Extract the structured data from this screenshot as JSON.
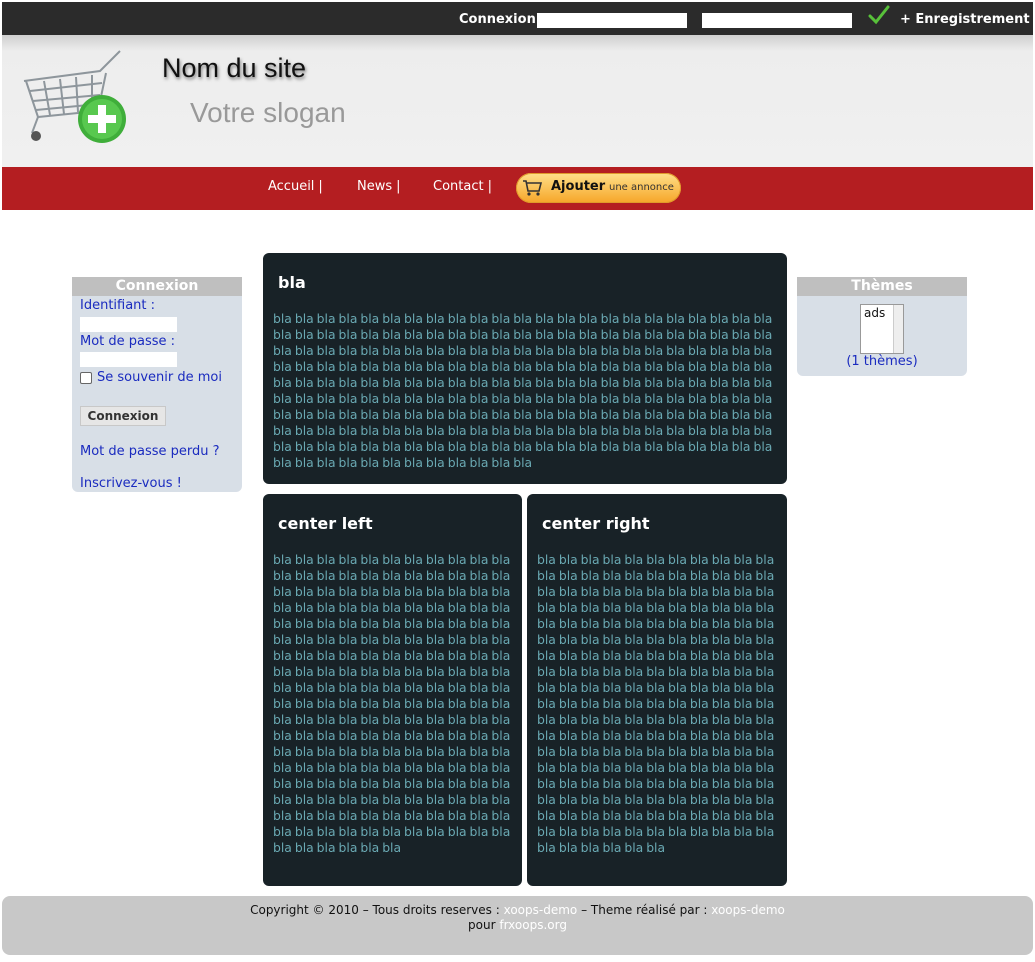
{
  "topbar": {
    "login_label": "Connexion",
    "register_label": "+ Enregistrement"
  },
  "header": {
    "site_name": "Nom du site",
    "slogan": "Votre slogan"
  },
  "menu": {
    "items": [
      "Accueil",
      "News",
      "Contact"
    ],
    "separator": "|",
    "add_button": {
      "main": "Ajouter",
      "sub": "une annonce"
    }
  },
  "login_box": {
    "title": "Connexion",
    "username_label": "Identifiant :",
    "password_label": "Mot de passe :",
    "remember_label": "Se souvenir de moi",
    "submit_label": "Connexion",
    "lost_password": "Mot de passe perdu ?",
    "register": "Inscrivez-vous !"
  },
  "themes_box": {
    "title": "Thèmes",
    "option": "ads",
    "count": "(1 thèmes)"
  },
  "blocks": {
    "top": {
      "title": "bla",
      "body": "bla bla bla bla bla bla bla bla bla bla bla bla bla bla bla bla bla bla bla bla bla bla bla bla bla bla bla bla bla bla bla bla bla bla bla bla bla bla bla bla bla bla bla bla bla bla bla bla bla bla bla bla bla bla bla bla bla bla bla bla bla bla bla bla bla bla bla bla bla bla bla bla bla bla bla bla bla bla bla bla bla bla bla bla bla bla bla bla bla bla bla bla bla bla bla bla bla bla bla bla bla bla bla bla bla bla bla bla bla bla bla bla bla bla bla bla bla bla bla bla bla bla bla bla bla bla bla bla bla bla bla bla bla bla bla bla bla bla bla bla bla bla bla bla bla bla bla bla bla bla bla bla bla bla bla bla bla bla bla bla bla bla bla bla bla bla bla bla bla bla bla bla bla bla bla bla bla bla bla bla bla bla bla bla bla bla bla bla bla bla bla bla bla bla bla bla bla bla bla bla bla bla bla bla bla bla bla bla bla bla bla bla bla bla bla bla bla bla bla"
    },
    "center_left": {
      "title": "center left",
      "body": "bla bla bla bla bla bla bla bla bla bla bla bla bla bla bla bla bla bla bla bla bla bla bla bla bla bla bla bla bla bla bla bla bla bla bla bla bla bla bla bla bla bla bla bla bla bla bla bla bla bla bla bla bla bla bla bla bla bla bla bla bla bla bla bla bla bla bla bla bla bla bla bla bla bla bla bla bla bla bla bla bla bla bla bla bla bla bla bla bla bla bla bla bla bla bla bla bla bla bla bla bla bla bla bla bla bla bla bla bla bla bla bla bla bla bla bla bla bla bla bla bla bla bla bla bla bla bla bla bla bla bla bla bla bla bla bla bla bla bla bla bla bla bla bla bla bla bla bla bla bla bla bla bla bla bla bla bla bla bla bla bla bla bla bla bla bla bla bla bla bla bla bla bla bla bla bla bla bla bla bla bla bla bla bla bla bla bla bla bla bla bla bla bla bla bla bla bla bla bla bla bla bla bla bla"
    },
    "center_right": {
      "title": "center right",
      "body": "bla bla bla bla bla bla bla bla bla bla bla bla bla bla bla bla bla bla bla bla bla bla bla bla bla bla bla bla bla bla bla bla bla bla bla bla bla bla bla bla bla bla bla bla bla bla bla bla bla bla bla bla bla bla bla bla bla bla bla bla bla bla bla bla bla bla bla bla bla bla bla bla bla bla bla bla bla bla bla bla bla bla bla bla bla bla bla bla bla bla bla bla bla bla bla bla bla bla bla bla bla bla bla bla bla bla bla bla bla bla bla bla bla bla bla bla bla bla bla bla bla bla bla bla bla bla bla bla bla bla bla bla bla bla bla bla bla bla bla bla bla bla bla bla bla bla bla bla bla bla bla bla bla bla bla bla bla bla bla bla bla bla bla bla bla bla bla bla bla bla bla bla bla bla bla bla bla bla bla bla bla bla bla bla bla bla bla bla bla bla bla bla bla bla bla bla bla bla bla bla bla bla bla bla"
    }
  },
  "footer": {
    "copyright": "Copyright © 2010 – Tous droits reserves :",
    "link1": "xoops-demo",
    "theme_by": "– Theme réalisé par :",
    "link2": "xoops-demo",
    "pour": "pour",
    "link3": "frxoops.org"
  },
  "colors": {
    "menu_red": "#b41e21",
    "block_dark": "#182227",
    "block_text": "#6aa9b3",
    "link_blue": "#1a2bbf"
  }
}
